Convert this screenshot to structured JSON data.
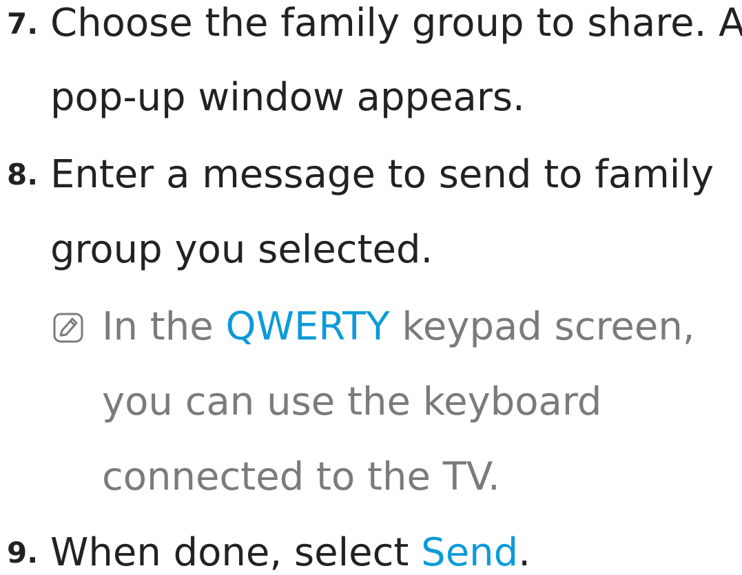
{
  "steps": [
    {
      "number": "7.",
      "line1": "Choose the family group to share. A",
      "line2": "pop-up window appears."
    },
    {
      "number": "8.",
      "line1": "Enter a message to send to family",
      "line2": "group you selected."
    },
    {
      "number": "9.",
      "text_before": "When done, select ",
      "highlight": "Send",
      "text_after": "."
    }
  ],
  "note": {
    "icon": "note-icon",
    "line1_before": "In the ",
    "line1_highlight": "QWERTY",
    "line1_after": " keypad screen,",
    "line2": "you can use the keyboard",
    "line3": "connected to the TV."
  },
  "colors": {
    "body_text": "#222222",
    "note_text": "#7b7b7b",
    "highlight": "#0d9bd8"
  }
}
